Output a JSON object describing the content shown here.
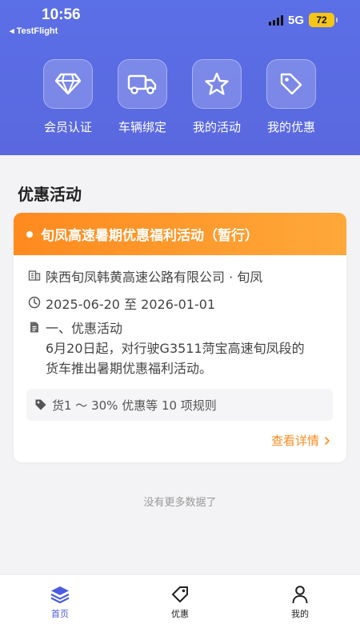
{
  "status_bar": {
    "time": "10:56",
    "back_app": "◂ TestFlight",
    "network": "5G",
    "battery": "72"
  },
  "quick_actions": [
    {
      "label": "会员认证",
      "icon": "diamond-icon"
    },
    {
      "label": "车辆绑定",
      "icon": "truck-icon"
    },
    {
      "label": "我的活动",
      "icon": "star-icon"
    },
    {
      "label": "我的优惠",
      "icon": "tag-icon"
    }
  ],
  "section_title": "优惠活动",
  "activity_card": {
    "title": "旬凤高速暑期优惠福利活动（暂行）",
    "company": "陕西旬凤韩黄高速公路有限公司 · 旬凤",
    "date_range": "2025-06-20 至 2026-01-01",
    "desc_line1": "一、优惠活动",
    "desc_line2": "6月20日起，对行驶G3511菏宝高速旬凤段的",
    "desc_line3": "货车推出暑期优惠福利活动。",
    "rules": "货1 ～ 30% 优惠等 10 项规则",
    "detail_link": "查看详情"
  },
  "no_more_text": "没有更多数据了",
  "tabbar": [
    {
      "label": "首页",
      "icon": "home-layers-icon",
      "active": true
    },
    {
      "label": "优惠",
      "icon": "tag-icon",
      "active": false
    },
    {
      "label": "我的",
      "icon": "user-icon",
      "active": false
    }
  ],
  "colors": {
    "header": "#5b6fe6",
    "accent_orange": "#ff8a1e",
    "active_tab": "#4a5de0"
  }
}
